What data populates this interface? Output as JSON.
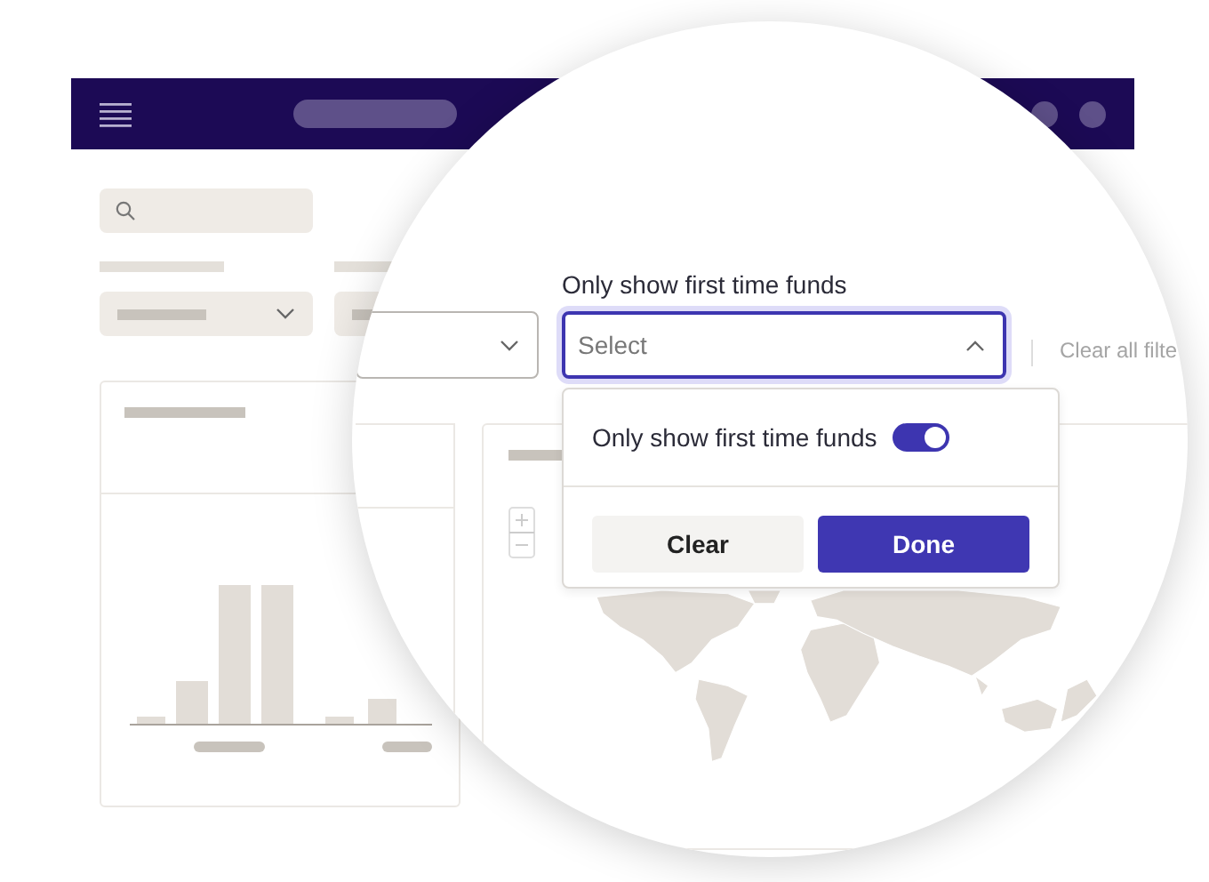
{
  "filter": {
    "label": "Only show first time funds",
    "placeholder": "Select",
    "expanded": true
  },
  "clear_all": "Clear all filte",
  "dropdown": {
    "option": {
      "label": "Only show first time funds",
      "on": true
    },
    "buttons": [
      {
        "label": "Clear",
        "kind": "secondary"
      },
      {
        "label": "Done",
        "kind": "primary"
      }
    ]
  }
}
